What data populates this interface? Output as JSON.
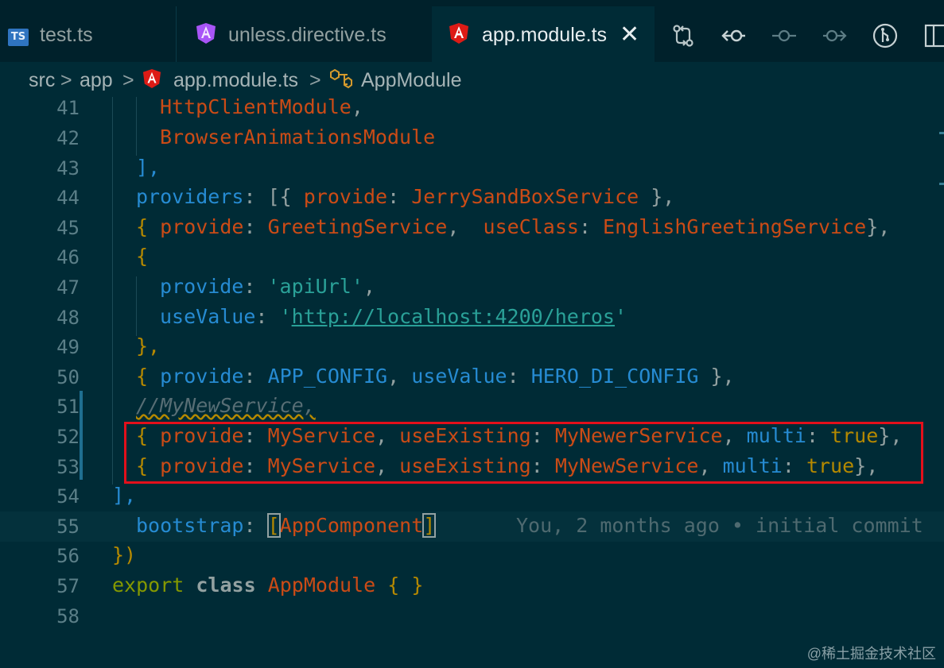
{
  "tabs": [
    {
      "label": "test.ts",
      "icon": "typescript-icon",
      "active": false
    },
    {
      "label": "unless.directive.ts",
      "icon": "angular-icon-purple",
      "active": false
    },
    {
      "label": "app.module.ts",
      "icon": "angular-icon-red",
      "active": true,
      "close": "✕"
    }
  ],
  "ts_badge": "TS",
  "breadcrumb": {
    "items": [
      "src",
      "app",
      "app.module.ts",
      "AppModule"
    ],
    "separator": ">"
  },
  "editor": {
    "line_numbers": [
      "41",
      "42",
      "43",
      "44",
      "45",
      "46",
      "47",
      "48",
      "49",
      "50",
      "51",
      "52",
      "53",
      "54",
      "55",
      "56",
      "57",
      "58"
    ],
    "blame": "You, 2 months ago • initial commit",
    "lines": {
      "l41": "HttpClientModule",
      "l41_end": ",",
      "l42": "BrowserAnimationsModule",
      "l43": "],",
      "l44_key": "providers",
      "l44_rest": ": [{ ",
      "l44_k2": "provide",
      "l44_colon": ": ",
      "l44_val": "JerrySandBoxService",
      "l44_end": " },",
      "l45_open": "{ ",
      "l45_k1": "provide",
      "l45_c1": ": ",
      "l45_v1": "GreetingService",
      "l45_mid": ",  ",
      "l45_k2": "useClass",
      "l45_c2": ": ",
      "l45_v2": "EnglishGreetingService",
      "l45_end": "},",
      "l46": "{",
      "l47_k": "provide",
      "l47_c": ": ",
      "l47_v": "'apiUrl'",
      "l47_end": ",",
      "l48_k": "useValue",
      "l48_c": ": ",
      "l48_q1": "'",
      "l48_url": "http://localhost:4200/heros",
      "l48_q2": "'",
      "l49": "},",
      "l50_open": "{ ",
      "l50_k1": "provide",
      "l50_c1": ": ",
      "l50_v1": "APP_CONFIG",
      "l50_mid": ", ",
      "l50_k2": "useValue",
      "l50_c2": ": ",
      "l50_v2": "HERO_DI_CONFIG",
      "l50_end": " },",
      "l51": "//MyNewService,",
      "l52_open": "{ ",
      "l52_k1": "provide",
      "l52_c1": ": ",
      "l52_v1": "MyService",
      "l52_m1": ", ",
      "l52_k2": "useExisting",
      "l52_c2": ": ",
      "l52_v2": "MyNewerService",
      "l52_m2": ", ",
      "l52_k3": "multi",
      "l52_c3": ": ",
      "l52_v3": "true",
      "l52_end": "},",
      "l53_open": "{ ",
      "l53_k1": "provide",
      "l53_c1": ": ",
      "l53_v1": "MyService",
      "l53_m1": ", ",
      "l53_k2": "useExisting",
      "l53_c2": ": ",
      "l53_v2": "MyNewService",
      "l53_m2": ", ",
      "l53_k3": "multi",
      "l53_c3": ": ",
      "l53_v3": "true",
      "l53_end": "},",
      "l54": "],",
      "l55_k": "bootstrap",
      "l55_c": ": ",
      "l55_ob": "[",
      "l55_v": "AppComponent",
      "l55_cb": "]",
      "l56": "})",
      "l57_kw": "export",
      "l57_cls": "class",
      "l57_name": "AppModule",
      "l57_body": "{ }"
    }
  },
  "watermark": "@稀土掘金技术社区",
  "colors": {
    "background": "#002b36",
    "highlight_box": "#e3101b",
    "tab_bar": "#00212b"
  }
}
